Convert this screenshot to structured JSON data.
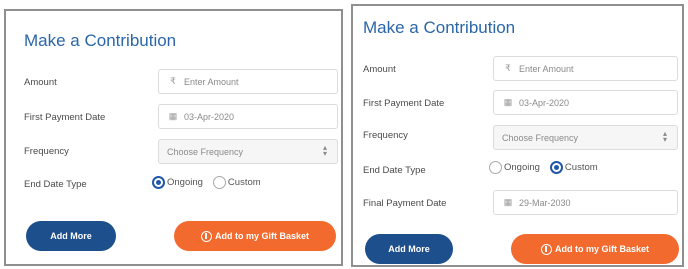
{
  "left": {
    "title": "Make a Contribution",
    "amount_label": "Amount",
    "amount_placeholder": "Enter Amount",
    "amount_icon": "₹",
    "first_payment_label": "First Payment Date",
    "first_payment_value": "03-Apr-2020",
    "frequency_label": "Frequency",
    "frequency_value": "Choose Frequency",
    "end_date_type_label": "End Date Type",
    "option_ongoing": "Ongoing",
    "option_custom": "Custom",
    "selected": "Ongoing",
    "add_more_label": "Add More",
    "add_to_basket_label": "Add to my Gift Basket"
  },
  "right": {
    "title": "Make a Contribution",
    "amount_label": "Amount",
    "amount_placeholder": "Enter Amount",
    "amount_icon": "₹",
    "first_payment_label": "First Payment Date",
    "first_payment_value": "03-Apr-2020",
    "frequency_label": "Frequency",
    "frequency_value": "Choose Frequency",
    "end_date_type_label": "End Date Type",
    "option_ongoing": "Ongoing",
    "option_custom": "Custom",
    "selected": "Custom",
    "final_payment_label": "Final Payment Date",
    "final_payment_value": "29-Mar-2030",
    "add_more_label": "Add More",
    "add_to_basket_label": "Add to my Gift Basket"
  },
  "colors": {
    "title": "#2b66a8",
    "primary_button": "#1d4f8c",
    "accent_button": "#f26a2e",
    "radio_selected": "#2157a8"
  },
  "icons": {
    "amount": "rupee-icon",
    "date": "calendar-icon",
    "select": "chevron-updown-icon",
    "basket": "gift-icon"
  }
}
